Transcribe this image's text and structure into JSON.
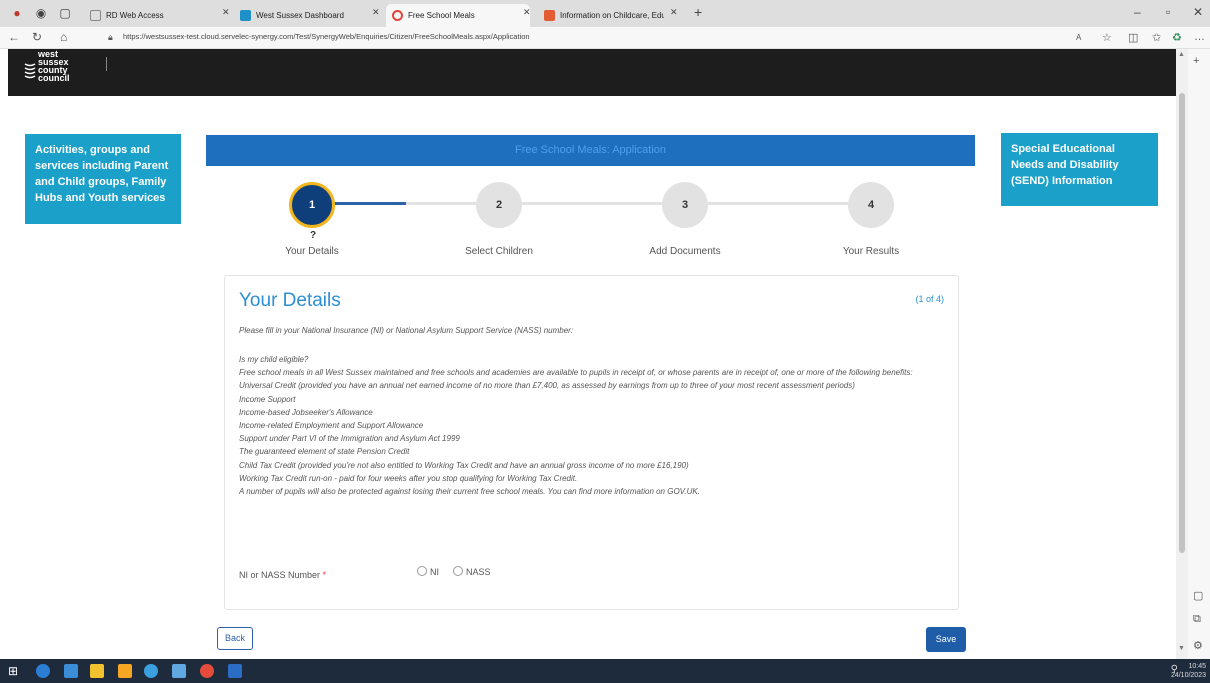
{
  "browser": {
    "tabs": [
      {
        "label": "RD Web Access",
        "active": false
      },
      {
        "label": "West Sussex Dashboard",
        "active": false
      },
      {
        "label": "Free School Meals",
        "active": true
      },
      {
        "label": "Information on Childcare, Educa",
        "active": false
      }
    ],
    "new_tab": "+",
    "url": "https://westsussex-test.cloud.servelec-synergy.com/Test/SynergyWeb/Enquiries/Citizen/FreeSchoolMeals.aspx/Application"
  },
  "site": {
    "logo_lines": [
      "west",
      "sussex",
      "county",
      "council"
    ]
  },
  "left_box": "Activities, groups and services including Parent and Child groups, Family Hubs and Youth services",
  "right_box": "Special Educational Needs and Disability (SEND) Information",
  "app_title": "Free School Meals: Application",
  "steps": [
    {
      "number": "1",
      "label": "Your Details"
    },
    {
      "number": "2",
      "label": "Select Children"
    },
    {
      "number": "3",
      "label": "Add Documents"
    },
    {
      "number": "4",
      "label": "Your Results"
    }
  ],
  "step_help": "?",
  "card": {
    "title": "Your Details",
    "count": "(1 of 4)",
    "intro": "Please fill in your National Insurance (NI) or National Asylum Support Service (NASS) number:",
    "lines": [
      "Is my child eligible?",
      "Free school meals in all West Sussex maintained and free schools and academies are available to pupils in receipt of, or whose parents are in receipt of, one or more of the following benefits:",
      "Universal Credit (provided you have an annual net earned income of no more than £7,400, as assessed by earnings from up to three of your most recent assessment periods)",
      "Income Support",
      "Income-based Jobseeker's Allowance",
      "Income-related Employment and Support Allowance",
      "Support under Part VI of the Immigration and Asylum Act 1999",
      "The guaranteed element of state Pension Credit",
      "Child Tax Credit (provided you're not also entitled to Working Tax Credit and have an annual gross income of no more £16,190)",
      "Working Tax Credit run-on - paid for four weeks after you stop qualifying for Working Tax Credit.",
      "A number of pupils will also be protected against losing their current free school meals. You can find more information on GOV.UK."
    ],
    "field_label": "NI or NASS Number",
    "required_mark": "*",
    "options": [
      "NI",
      "NASS"
    ]
  },
  "buttons": {
    "back": "Back",
    "save": "Save"
  },
  "taskbar": {
    "time": "10:45",
    "date": "24/10/2023"
  }
}
